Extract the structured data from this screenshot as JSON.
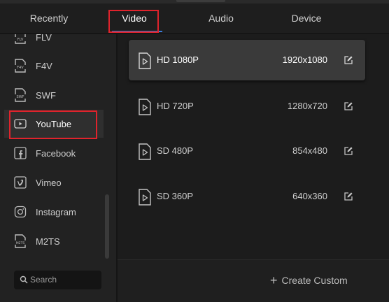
{
  "tabs": [
    {
      "label": "Recently"
    },
    {
      "label": "Video"
    },
    {
      "label": "Audio"
    },
    {
      "label": "Device"
    }
  ],
  "active_tab": "Video",
  "sidebar": {
    "items": [
      {
        "label": "FLV",
        "icon": "flv-file-icon"
      },
      {
        "label": "F4V",
        "icon": "f4v-file-icon"
      },
      {
        "label": "SWF",
        "icon": "swf-file-icon"
      },
      {
        "label": "YouTube",
        "icon": "youtube-play-icon"
      },
      {
        "label": "Facebook",
        "icon": "facebook-icon"
      },
      {
        "label": "Vimeo",
        "icon": "vimeo-icon"
      },
      {
        "label": "Instagram",
        "icon": "instagram-icon"
      },
      {
        "label": "M2TS",
        "icon": "m2ts-file-icon"
      }
    ],
    "active_item": "YouTube",
    "search_placeholder": "Search"
  },
  "presets": [
    {
      "name": "HD 1080P",
      "resolution": "1920x1080"
    },
    {
      "name": "HD 720P",
      "resolution": "1280x720"
    },
    {
      "name": "SD 480P",
      "resolution": "854x480"
    },
    {
      "name": "SD 360P",
      "resolution": "640x360"
    }
  ],
  "selected_preset": "HD 1080P",
  "footer": {
    "create_label": "Create Custom"
  },
  "colors": {
    "highlight_box": "#e0232c",
    "tab_underline": "#3b7bd8"
  }
}
